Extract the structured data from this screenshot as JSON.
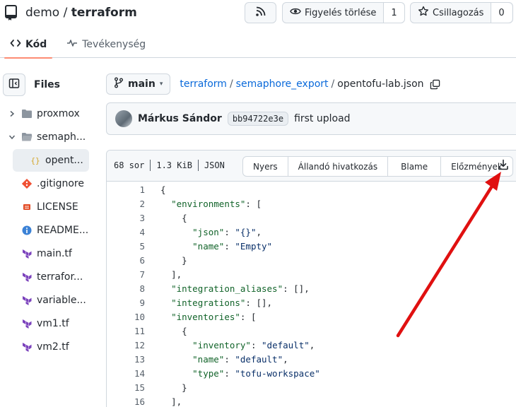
{
  "repo": {
    "owner": "demo",
    "separator": " / ",
    "name": "terraform"
  },
  "header_buttons": {
    "watch_label": "Figyelés törlése",
    "watch_count": "1",
    "star_label": "Csillagozás",
    "star_count": "0"
  },
  "tabs": [
    {
      "label": "Kód",
      "icon": "code-icon",
      "active": true
    },
    {
      "label": "Tevékenység",
      "icon": "pulse-icon",
      "active": false
    }
  ],
  "sidebar": {
    "title": "Files",
    "items": [
      {
        "label": "proxmox",
        "type": "folder",
        "expanded": false
      },
      {
        "label": "semaph...",
        "type": "folder",
        "expanded": true
      },
      {
        "label": "opent...",
        "type": "json-file",
        "selected": true
      },
      {
        "label": ".gitignore",
        "type": "git-file"
      },
      {
        "label": "LICENSE",
        "type": "license-file"
      },
      {
        "label": "README...",
        "type": "info-file"
      },
      {
        "label": "main.tf",
        "type": "terraform-file"
      },
      {
        "label": "terrafor...",
        "type": "terraform-file"
      },
      {
        "label": "variable...",
        "type": "terraform-file"
      },
      {
        "label": "vm1.tf",
        "type": "terraform-file"
      },
      {
        "label": "vm2.tf",
        "type": "terraform-file"
      }
    ]
  },
  "branch": "main",
  "breadcrumb": {
    "parts": [
      "terraform",
      "semaphore_export"
    ],
    "current": "opentofu-lab.json"
  },
  "commit": {
    "author": "Márkus Sándor",
    "sha": "bb94722e3e",
    "message": "first upload"
  },
  "file_meta": {
    "lines": "68 sor",
    "size": "1.3 KiB",
    "type": "JSON"
  },
  "file_buttons": [
    "Nyers",
    "Állandó hivatkozás",
    "Blame",
    "Előzmények"
  ],
  "code_lines": [
    {
      "n": "1",
      "indent": "",
      "parts": [
        [
          "p",
          "{"
        ]
      ]
    },
    {
      "n": "2",
      "indent": "  ",
      "parts": [
        [
          "k",
          "\"environments\""
        ],
        [
          "p",
          ": ["
        ]
      ]
    },
    {
      "n": "3",
      "indent": "    ",
      "parts": [
        [
          "p",
          "{"
        ]
      ]
    },
    {
      "n": "4",
      "indent": "      ",
      "parts": [
        [
          "k",
          "\"json\""
        ],
        [
          "p",
          ": "
        ],
        [
          "s",
          "\"{}\""
        ],
        [
          "p",
          ","
        ]
      ]
    },
    {
      "n": "5",
      "indent": "      ",
      "parts": [
        [
          "k",
          "\"name\""
        ],
        [
          "p",
          ": "
        ],
        [
          "s",
          "\"Empty\""
        ]
      ]
    },
    {
      "n": "6",
      "indent": "    ",
      "parts": [
        [
          "p",
          "}"
        ]
      ]
    },
    {
      "n": "7",
      "indent": "  ",
      "parts": [
        [
          "p",
          "],"
        ]
      ]
    },
    {
      "n": "8",
      "indent": "  ",
      "parts": [
        [
          "k",
          "\"integration_aliases\""
        ],
        [
          "p",
          ": [],"
        ]
      ]
    },
    {
      "n": "9",
      "indent": "  ",
      "parts": [
        [
          "k",
          "\"integrations\""
        ],
        [
          "p",
          ": [],"
        ]
      ]
    },
    {
      "n": "10",
      "indent": "  ",
      "parts": [
        [
          "k",
          "\"inventories\""
        ],
        [
          "p",
          ": ["
        ]
      ]
    },
    {
      "n": "11",
      "indent": "    ",
      "parts": [
        [
          "p",
          "{"
        ]
      ]
    },
    {
      "n": "12",
      "indent": "      ",
      "parts": [
        [
          "k",
          "\"inventory\""
        ],
        [
          "p",
          ": "
        ],
        [
          "s",
          "\"default\""
        ],
        [
          "p",
          ","
        ]
      ]
    },
    {
      "n": "13",
      "indent": "      ",
      "parts": [
        [
          "k",
          "\"name\""
        ],
        [
          "p",
          ": "
        ],
        [
          "s",
          "\"default\""
        ],
        [
          "p",
          ","
        ]
      ]
    },
    {
      "n": "14",
      "indent": "      ",
      "parts": [
        [
          "k",
          "\"type\""
        ],
        [
          "p",
          ": "
        ],
        [
          "s",
          "\"tofu-workspace\""
        ]
      ]
    },
    {
      "n": "15",
      "indent": "    ",
      "parts": [
        [
          "p",
          "}"
        ]
      ]
    },
    {
      "n": "16",
      "indent": "  ",
      "parts": [
        [
          "p",
          "],"
        ]
      ]
    }
  ],
  "colors": {
    "link": "#0969da",
    "key": "#116329",
    "string": "#0a3069",
    "annotation_arrow": "#e01010"
  }
}
